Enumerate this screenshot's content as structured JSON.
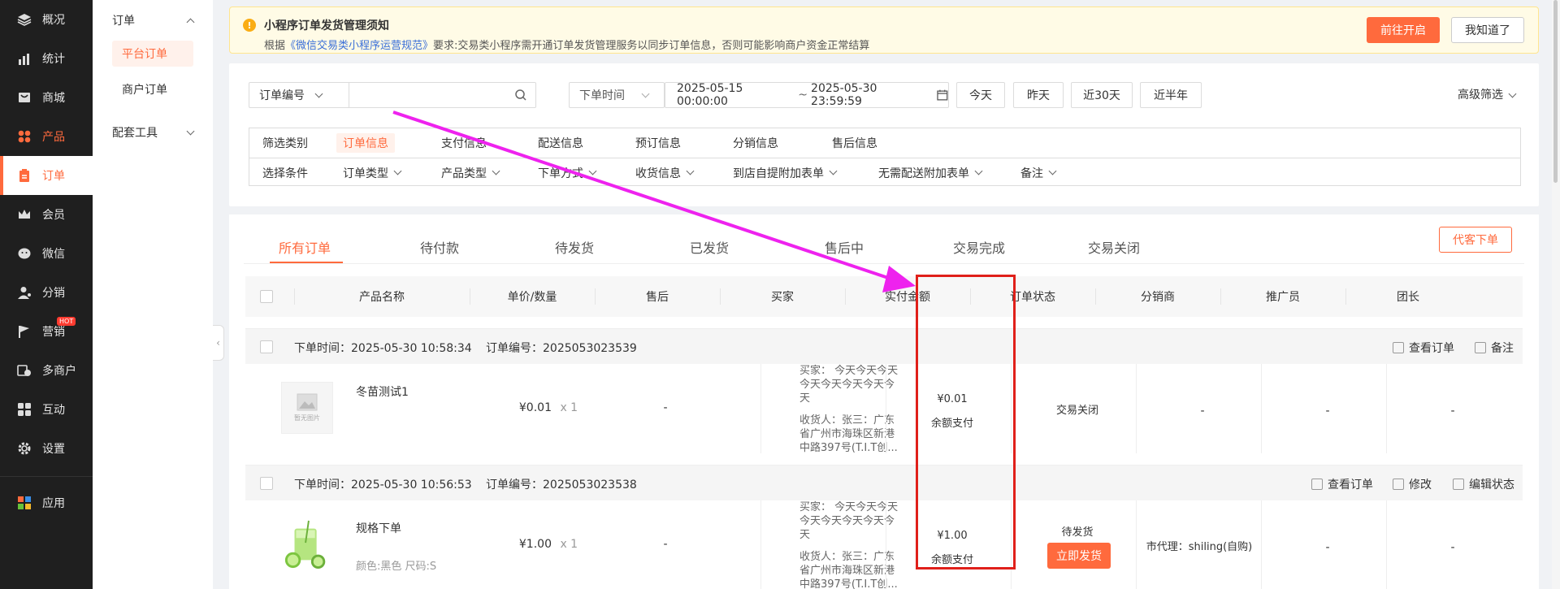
{
  "sidebar": {
    "items": [
      {
        "label": "概况",
        "icon": "layers-icon"
      },
      {
        "label": "统计",
        "icon": "chart-icon"
      },
      {
        "label": "商城",
        "icon": "shop-icon"
      },
      {
        "label": "产品",
        "icon": "product-icon"
      },
      {
        "label": "订单",
        "icon": "order-icon"
      },
      {
        "label": "会员",
        "icon": "crown-icon"
      },
      {
        "label": "微信",
        "icon": "wechat-icon"
      },
      {
        "label": "分销",
        "icon": "user-share-icon"
      },
      {
        "label": "营销",
        "icon": "flag-icon",
        "badge": "HOT"
      },
      {
        "label": "多商户",
        "icon": "multi-store-icon"
      },
      {
        "label": "互动",
        "icon": "interact-icon"
      },
      {
        "label": "设置",
        "icon": "gear-icon"
      }
    ],
    "apps_label": "应用",
    "accent": "#ff6a3d"
  },
  "subnav": {
    "group1": "订单",
    "items": [
      "平台订单",
      "商户订单"
    ],
    "group2": "配套工具"
  },
  "notice": {
    "title": "小程序订单发货管理须知",
    "desc_prefix": "根据",
    "desc_link": "《微信交易类小程序运营规范》",
    "desc_suffix": "要求:交易类小程序需开通订单发货管理服务以同步订单信息，否则可能影响商户资金正常结算",
    "btn_open": "前往开启",
    "btn_ack": "我知道了"
  },
  "filter": {
    "search_type": "订单编号",
    "search_value": "",
    "time_type": "下单时间",
    "date_start": "2025-05-15 00:00:00",
    "date_sep": "~",
    "date_end": "2025-05-30 23:59:59",
    "quick": [
      "今天",
      "昨天",
      "近30天",
      "近半年"
    ],
    "advanced": "高级筛选",
    "category_label": "筛选类别",
    "categories": [
      "订单信息",
      "支付信息",
      "配送信息",
      "预订信息",
      "分销信息",
      "售后信息"
    ],
    "condition_label": "选择条件",
    "conditions": [
      "订单类型",
      "产品类型",
      "下单方式",
      "收货信息",
      "到店自提附加表单",
      "无需配送附加表单",
      "备注"
    ]
  },
  "tabs": [
    "所有订单",
    "待付款",
    "待发货",
    "已发货",
    "售后中",
    "交易完成",
    "交易关闭"
  ],
  "proxy_order_btn": "代客下单",
  "columns": [
    "产品名称",
    "单价/数量",
    "售后",
    "买家",
    "实付金额",
    "订单状态",
    "分销商",
    "推广员",
    "团长"
  ],
  "orders": [
    {
      "time_label": "下单时间：2025-05-30 10:58:34",
      "no_label": "订单编号：2025053023539",
      "actions": [
        "查看订单",
        "备注"
      ],
      "product": "冬苗测试1",
      "spec": "",
      "no_image": "暂无图片",
      "price": "¥0.01",
      "qty": "x 1",
      "after_sale": "-",
      "buyer": "买家： 今天今天今天今天今天今天今天今天",
      "receiver": "收货人：张三：广东省广州市海珠区新港中路397号(T.I.T创...",
      "paid": "¥0.01",
      "pay_method": "余额支付",
      "status": "交易关闭",
      "ship_btn": "",
      "distributor": "-",
      "promoter": "-",
      "leader": "-"
    },
    {
      "time_label": "下单时间：2025-05-30 10:56:53",
      "no_label": "订单编号：2025053023538",
      "actions": [
        "查看订单",
        "修改",
        "编辑状态"
      ],
      "product": "规格下单",
      "spec": "颜色:黑色 尺码:S",
      "no_image": "",
      "price": "¥1.00",
      "qty": "x 1",
      "after_sale": "-",
      "buyer": "买家： 今天今天今天今天今天今天今天今天",
      "receiver": "收货人：张三：广东省广州市海珠区新港中路397号(T.I.T创...",
      "paid": "¥1.00",
      "pay_method": "余额支付",
      "status": "待发货",
      "ship_btn": "立即发货",
      "distributor": "市代理：shiling(自购)",
      "promoter": "-",
      "leader": "-"
    }
  ]
}
